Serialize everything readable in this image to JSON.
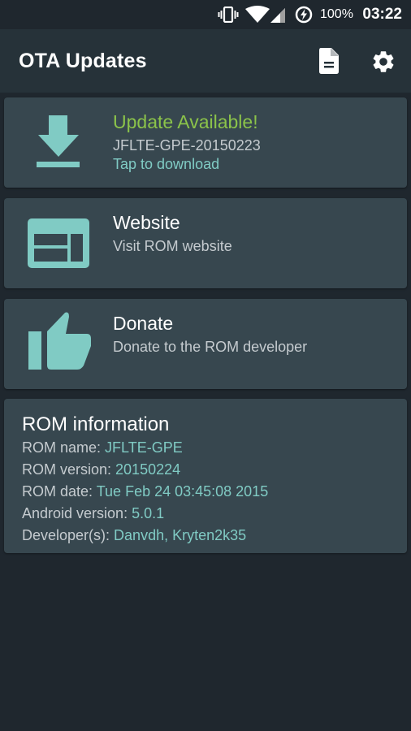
{
  "status_bar": {
    "battery_percent": "100%",
    "time": "03:22",
    "icons": [
      "vibrate-icon",
      "wifi-icon",
      "cell-signal-icon",
      "battery-charging-icon"
    ]
  },
  "app_bar": {
    "title": "OTA Updates",
    "actions": [
      {
        "name": "changelog",
        "icon": "document-icon"
      },
      {
        "name": "settings",
        "icon": "gear-icon"
      }
    ]
  },
  "cards": {
    "update": {
      "title": "Update Available!",
      "version": "JFLTE-GPE-20150223",
      "action": "Tap to download",
      "icon": "download-icon"
    },
    "website": {
      "title": "Website",
      "subtitle": "Visit ROM website",
      "icon": "web-icon"
    },
    "donate": {
      "title": "Donate",
      "subtitle": "Donate to the ROM developer",
      "icon": "thumb-up-icon"
    }
  },
  "rom_info": {
    "title": "ROM information",
    "rows": [
      {
        "label": "ROM name: ",
        "value": "JFLTE-GPE"
      },
      {
        "label": "ROM version: ",
        "value": "20150224"
      },
      {
        "label": "ROM date: ",
        "value": "Tue Feb 24 03:45:08 2015"
      },
      {
        "label": "Android version: ",
        "value": "5.0.1"
      },
      {
        "label": "Developer(s): ",
        "value": "Danvdh, Kryten2k35"
      }
    ]
  },
  "colors": {
    "accent": "#80cbc4",
    "update_green": "#8bc34a",
    "card_bg": "#37474f",
    "app_bar": "#263239",
    "background": "#1f272e"
  }
}
